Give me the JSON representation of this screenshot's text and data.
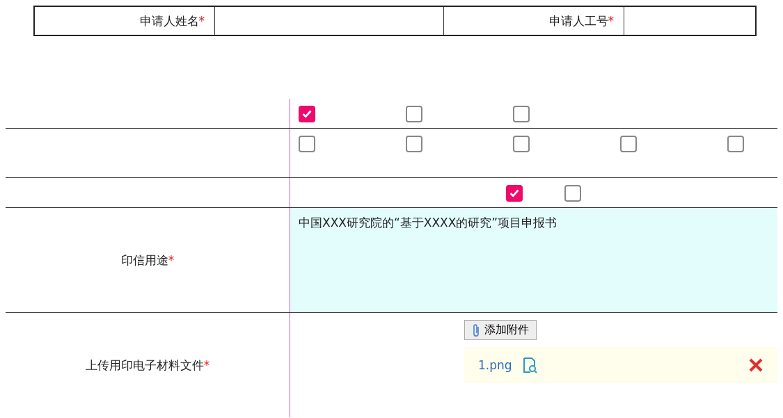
{
  "applicant_fields": [
    {
      "label": "申请人姓名",
      "mark": "*"
    },
    {
      "label": "申请人工号",
      "mark": "*"
    }
  ],
  "option_groups": [
    {
      "options": [
        {
          "checked": true
        },
        {
          "checked": false
        },
        {
          "checked": false
        }
      ]
    },
    {
      "options": [
        {
          "checked": false
        },
        {
          "checked": false
        },
        {
          "checked": false
        },
        {
          "checked": false
        },
        {
          "checked": false
        }
      ]
    },
    {
      "options": [
        {
          "checked": true
        },
        {
          "checked": false
        }
      ]
    }
  ],
  "purpose": {
    "label": "印信用途",
    "mark": "*",
    "value": "中国XXX研究院的“基于XXXX的研究”项目申报书"
  },
  "upload": {
    "label": "上传用印电子材料文件",
    "mark": "*",
    "button": "添加附件",
    "files": [
      {
        "name": "1.png"
      }
    ]
  }
}
